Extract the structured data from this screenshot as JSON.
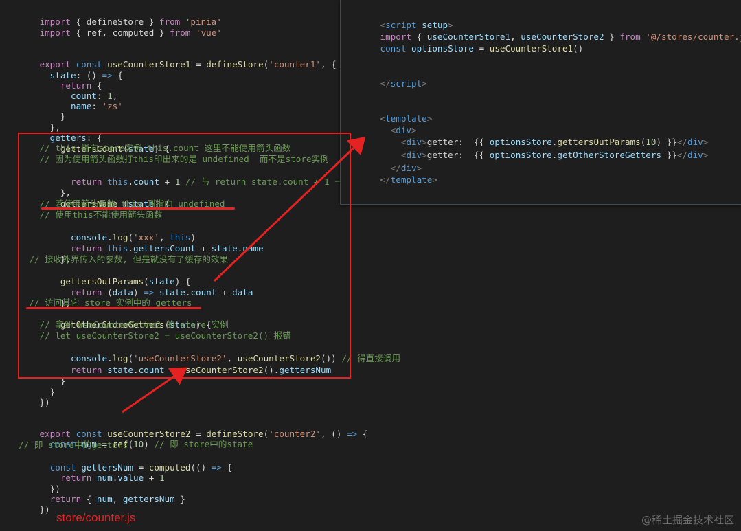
{
  "left_code": {
    "l01": [
      "import",
      " { defineStore } ",
      "from",
      " ",
      "'pinia'"
    ],
    "l02": [
      "import",
      " { ref, computed } ",
      "from",
      " ",
      "'vue'"
    ],
    "l05": [
      "export",
      " ",
      "const",
      " ",
      "useCounterStore1",
      " = ",
      "defineStore",
      "(",
      "'counter1'",
      ", {"
    ],
    "l06": [
      "  ",
      "state",
      ": () ",
      "=>",
      " {"
    ],
    "l07": [
      "    ",
      "return",
      " {"
    ],
    "l08": [
      "      ",
      "count",
      ": ",
      "1",
      ","
    ],
    "l09": [
      "      ",
      "name",
      ": ",
      "'zs'"
    ],
    "l10": [
      "    }"
    ],
    "l11": [
      "  },"
    ],
    "l12": [
      "  ",
      "getters",
      ": {"
    ],
    "l13": [
      "    ",
      "gettersCount",
      "(",
      "state",
      ") {"
    ],
    "l14": [
      "      // this 指向store实例 this.count 这里不能使用箭头函数"
    ],
    "l15": [
      "      // 因为使用箭头函数打this印出来的是 undefined  而不是store实例"
    ],
    "l16": [
      "      ",
      "return",
      " ",
      "this",
      ".",
      "count",
      " + ",
      "1",
      " ",
      "// 与 return state.count + 1 一致"
    ],
    "l17": [
      "    },"
    ],
    "l18": [
      "    ",
      "gettersName",
      " (",
      "state",
      ") {"
    ],
    "l19": [
      "      // 若使用箭头函数 this 则指向 undefined"
    ],
    "l20": [
      "      // 使用this不能使用箭头函数"
    ],
    "l21": [
      "      ",
      "console",
      ".",
      "log",
      "(",
      "'xxx'",
      ", ",
      "this",
      ")"
    ],
    "l22": [
      "      ",
      "return",
      " ",
      "this",
      ".",
      "gettersCount",
      " + ",
      "state",
      ".",
      "name"
    ],
    "l23": [
      "    },"
    ],
    "l24": [
      "    // 接收外界传入的参数, 但是就没有了缓存的效果"
    ],
    "l25": [
      "    ",
      "gettersOutParams",
      "(",
      "state",
      ") {"
    ],
    "l26": [
      "      ",
      "return",
      " (",
      "data",
      ") ",
      "=>",
      " ",
      "state",
      ".",
      "count",
      " + ",
      "data"
    ],
    "l27": [
      "    },"
    ],
    "l28": [
      "    // 访问其它 store 实例中的 getters"
    ],
    "l29": [
      "    ",
      "getOtherStoreGetters",
      "(",
      "state",
      ") {"
    ],
    "l30": [
      "      // 拿到 useCounterStore2 的 store 实例"
    ],
    "l31": [
      "      // let useCounterStore2 = useCounterStore2() 报错"
    ],
    "l32": [
      "      ",
      "console",
      ".",
      "log",
      "(",
      "'useCounterStore2'",
      ", ",
      "useCounterStore2",
      "()) ",
      "// 得直接调用"
    ],
    "l33": [
      "      ",
      "return",
      " ",
      "state",
      ".",
      "count",
      " + ",
      "useCounterStore2",
      "().",
      "gettersNum"
    ],
    "l34": [
      "    }"
    ],
    "l35": [
      "  }"
    ],
    "l36": [
      "})"
    ],
    "l39": [
      "export",
      " ",
      "const",
      " ",
      "useCounterStore2",
      " = ",
      "defineStore",
      "(",
      "'counter2'",
      ", () ",
      "=>",
      " {"
    ],
    "l40": [
      "  ",
      "const",
      " ",
      "num",
      " = ",
      "ref",
      "(",
      "10",
      ") ",
      "// 即 store中的state"
    ],
    "l41": [
      "  // 即 store中的getters"
    ],
    "l42": [
      "  ",
      "const",
      " ",
      "gettersNum",
      " = ",
      "computed",
      "(() ",
      "=>",
      " {"
    ],
    "l43": [
      "    ",
      "return",
      " ",
      "num",
      ".",
      "value",
      " + ",
      "1"
    ],
    "l44": [
      "  })"
    ],
    "l45": [
      "  ",
      "return",
      " { ",
      "num",
      ", ",
      "gettersNum",
      " }"
    ],
    "l46": [
      "})"
    ]
  },
  "right_code": {
    "r01": [
      "<",
      "script",
      " ",
      "setup",
      ">"
    ],
    "r02": [
      "import",
      " { ",
      "useCounterStore1",
      ", ",
      "useCounterStore2",
      " } ",
      "from",
      " ",
      "'@/stores/counter.js'"
    ],
    "r03": [
      "const",
      " ",
      "optionsStore",
      " = ",
      "useCounterStore1",
      "()"
    ],
    "r06": [
      "</",
      "script",
      ">"
    ],
    "r09": [
      "<",
      "template",
      ">"
    ],
    "r10": [
      "  ",
      "<",
      "div",
      ">"
    ],
    "r11": [
      "    ",
      "<",
      "div",
      ">",
      "getter:  {{ ",
      "optionsStore",
      ".",
      "gettersOutParams",
      "(",
      "10",
      ") }}",
      "</",
      "div",
      ">"
    ],
    "r12": [
      "    ",
      "<",
      "div",
      ">",
      "getter:  {{ ",
      "optionsStore",
      ".",
      "getOtherStoreGetters",
      " }}",
      "</",
      "div",
      ">"
    ],
    "r13": [
      "  ",
      "</",
      "div",
      ">"
    ],
    "r14": [
      "</",
      "template",
      ">"
    ]
  },
  "labels": {
    "file_label": "store/counter.js",
    "watermark": "@稀土掘金技术社区"
  },
  "colors": {
    "background": "#1e1e1e",
    "annotation_red": "#e52222",
    "keyword": "#569cd6",
    "control": "#c586c0",
    "function": "#dcdcaa",
    "string": "#ce9178",
    "variable": "#9cdcfe",
    "number": "#b5cea8",
    "comment": "#6a9955"
  }
}
